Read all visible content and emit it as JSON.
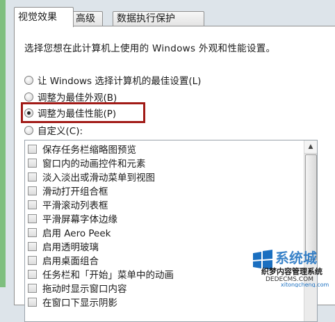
{
  "tabs": [
    {
      "label": "视觉效果",
      "active": true
    },
    {
      "label": "高级",
      "active": false
    },
    {
      "label": "数据执行保护",
      "active": false
    }
  ],
  "description": "选择您想在此计算机上使用的 Windows 外观和性能设置。",
  "radio_options": [
    {
      "label": "让 Windows 选择计算机的最佳设置(L)",
      "selected": false
    },
    {
      "label": "调整为最佳外观(B)",
      "selected": false
    },
    {
      "label": "调整为最佳性能(P)",
      "selected": true
    },
    {
      "label": "自定义(C):",
      "selected": false
    }
  ],
  "effects_list": [
    "保存任务栏缩略图预览",
    "窗口内的动画控件和元素",
    "淡入淡出或滑动菜单到视图",
    "滑动打开组合框",
    "平滑滚动列表框",
    "平滑屏幕字体边缘",
    "启用 Aero Peek",
    "启用透明玻璃",
    "启用桌面组合",
    "任务栏和「开始」菜单中的动画",
    "拖动时显示窗口内容",
    "在窗口下显示阴影"
  ],
  "watermark": {
    "brand": "系统城",
    "caption": "织梦内容管理系统",
    "url": "DEDECMS.COM",
    "site": "xitongcheng.com"
  },
  "colors": {
    "highlight_border": "#a11a16",
    "watermark_blue": "#1a6fc0"
  }
}
